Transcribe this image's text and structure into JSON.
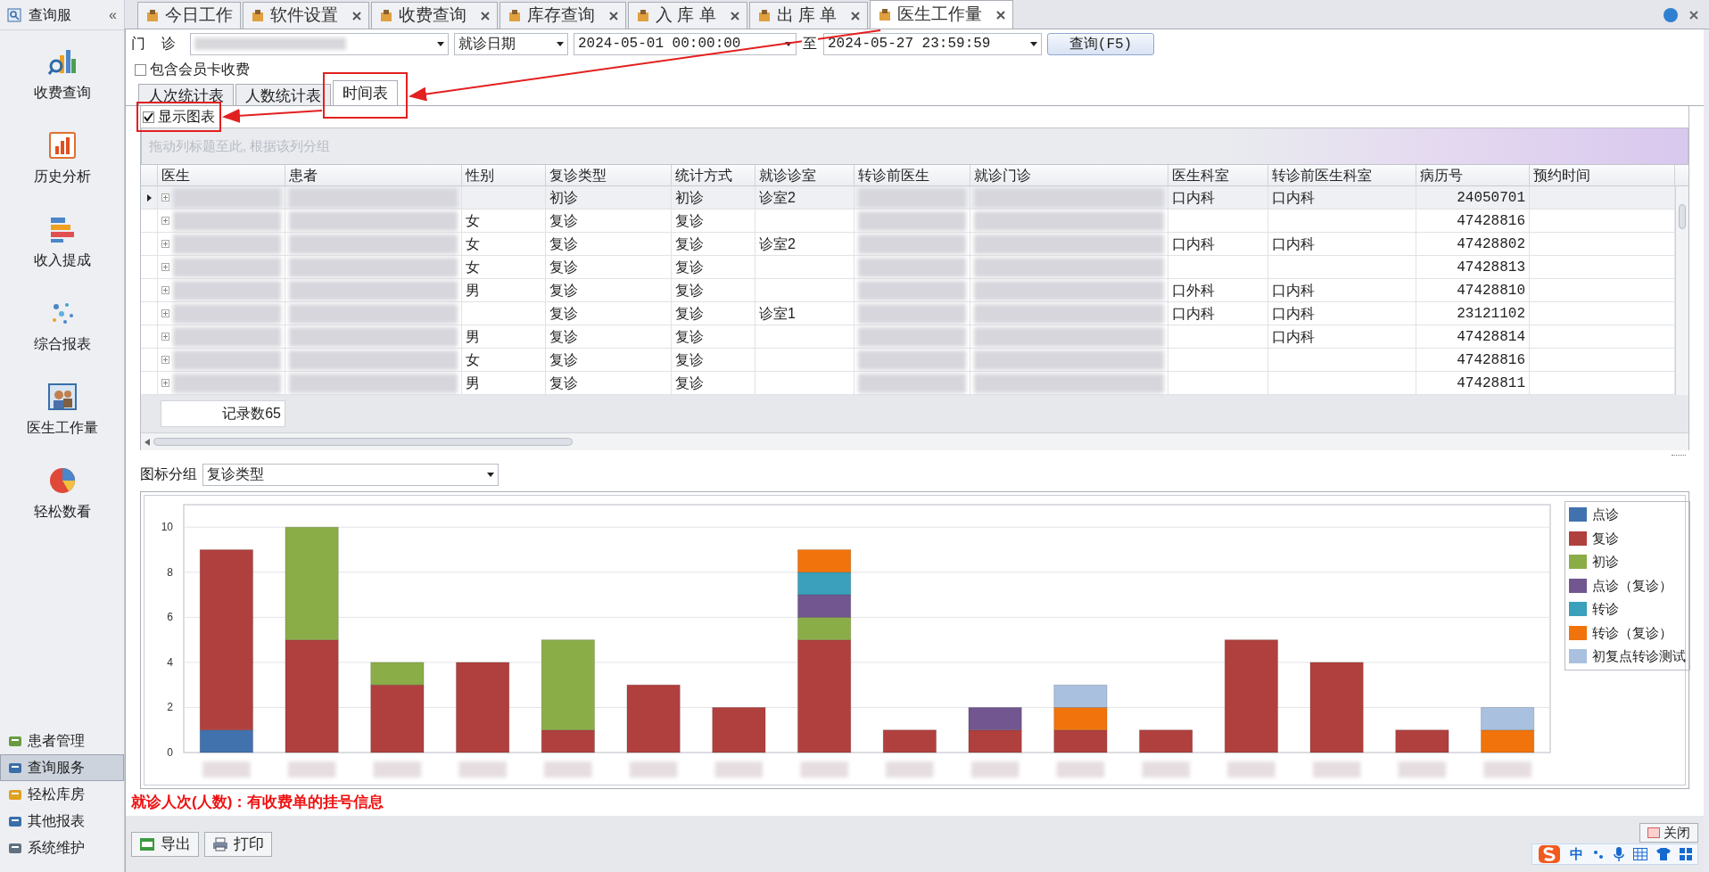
{
  "sidebar": {
    "title": "查询服",
    "collapse": "«",
    "items": [
      {
        "label": "收费查询"
      },
      {
        "label": "历史分析"
      },
      {
        "label": "收入提成"
      },
      {
        "label": "综合报表"
      },
      {
        "label": "医生工作量"
      },
      {
        "label": "轻松数看"
      }
    ],
    "nav": [
      {
        "label": "患者管理",
        "selected": false
      },
      {
        "label": "查询服务",
        "selected": true
      },
      {
        "label": "轻松库房",
        "selected": false
      },
      {
        "label": "其他报表",
        "selected": false
      },
      {
        "label": "系统维护",
        "selected": false
      }
    ]
  },
  "tabs": [
    {
      "label": "今日工作",
      "closable": false,
      "selected": false
    },
    {
      "label": "软件设置",
      "closable": true,
      "selected": false
    },
    {
      "label": "收费查询",
      "closable": true,
      "selected": false
    },
    {
      "label": "库存查询",
      "closable": true,
      "selected": false
    },
    {
      "label": "入 库 单",
      "closable": true,
      "selected": false
    },
    {
      "label": "出 库 单",
      "closable": true,
      "selected": false
    },
    {
      "label": "医生工作量",
      "closable": true,
      "selected": true
    }
  ],
  "filters": {
    "clinic_label": "门    诊",
    "date_type": "就诊日期",
    "start": "2024-05-01 00:00:00",
    "to": "至",
    "end": "2024-05-27 23:59:59",
    "query_button": "查询(F5)",
    "member_card": {
      "label": "包含会员卡收费",
      "checked": false
    }
  },
  "sub_tabs": [
    {
      "label": "人次统计表",
      "selected": false
    },
    {
      "label": "人数统计表",
      "selected": false
    },
    {
      "label": "时间表",
      "selected": true
    }
  ],
  "show_chart": {
    "label": "显示图表",
    "checked": true
  },
  "group_hint": "拖动列标题至此, 根据该列分组",
  "table": {
    "columns": [
      {
        "label": "医生",
        "redacted": true
      },
      {
        "label": "患者",
        "redacted": true
      },
      {
        "label": "性别",
        "redacted": false
      },
      {
        "label": "复诊类型",
        "redacted": false
      },
      {
        "label": "统计方式",
        "redacted": false
      },
      {
        "label": "就诊诊室",
        "redacted": false
      },
      {
        "label": "转诊前医生",
        "redacted": true
      },
      {
        "label": "就诊门诊",
        "redacted": true
      },
      {
        "label": "医生科室",
        "redacted": false
      },
      {
        "label": "转诊前医生科室",
        "redacted": false
      },
      {
        "label": "病历号",
        "redacted": false
      },
      {
        "label": "预约时间",
        "redacted": false
      }
    ],
    "rows": [
      {
        "selected": true,
        "cells": [
          "",
          "",
          "",
          "初诊",
          "初诊",
          "诊室2",
          "",
          "",
          "口内科",
          "口内科",
          "24050701",
          ""
        ]
      },
      {
        "selected": false,
        "cells": [
          "",
          "",
          "女",
          "复诊",
          "复诊",
          "",
          "",
          "",
          "",
          "",
          "47428816",
          ""
        ]
      },
      {
        "selected": false,
        "cells": [
          "",
          "",
          "女",
          "复诊",
          "复诊",
          "诊室2",
          "",
          "",
          "口内科",
          "口内科",
          "47428802",
          ""
        ]
      },
      {
        "selected": false,
        "cells": [
          "",
          "",
          "女",
          "复诊",
          "复诊",
          "",
          "",
          "",
          "",
          "",
          "47428813",
          ""
        ]
      },
      {
        "selected": false,
        "cells": [
          "",
          "",
          "男",
          "复诊",
          "复诊",
          "",
          "",
          "",
          "口外科",
          "口内科",
          "47428810",
          ""
        ]
      },
      {
        "selected": false,
        "cells": [
          "",
          "",
          "",
          "复诊",
          "复诊",
          "诊室1",
          "",
          "",
          "口内科",
          "口内科",
          "23121102",
          ""
        ]
      },
      {
        "selected": false,
        "cells": [
          "",
          "",
          "男",
          "复诊",
          "复诊",
          "",
          "",
          "",
          "",
          "口内科",
          "47428814",
          ""
        ]
      },
      {
        "selected": false,
        "cells": [
          "",
          "",
          "女",
          "复诊",
          "复诊",
          "",
          "",
          "",
          "",
          "",
          "47428816",
          ""
        ]
      },
      {
        "selected": false,
        "cells": [
          "",
          "",
          "男",
          "复诊",
          "复诊",
          "",
          "",
          "",
          "",
          "",
          "47428811",
          ""
        ]
      }
    ],
    "record_count": "记录数65"
  },
  "chart_group": {
    "label": "图标分组",
    "value": "复诊类型"
  },
  "chart": {
    "chart_data": {
      "type": "bar",
      "stacked": true,
      "grid": true,
      "ylim": [
        0,
        11
      ],
      "yticks": [
        0,
        2,
        4,
        6,
        8,
        10
      ],
      "series": [
        {
          "name": "点诊",
          "color": "#4272ae",
          "values": [
            1,
            0,
            0,
            0,
            0,
            0,
            0,
            0,
            0,
            0,
            0,
            0,
            0,
            0,
            0,
            0
          ]
        },
        {
          "name": "复诊",
          "color": "#b0403e",
          "values": [
            8,
            5,
            3,
            4,
            1,
            3,
            2,
            5,
            1,
            1,
            1,
            1,
            5,
            4,
            1,
            0
          ]
        },
        {
          "name": "初诊",
          "color": "#8bad48",
          "values": [
            0,
            5,
            1,
            0,
            4,
            0,
            0,
            1,
            0,
            0,
            0,
            0,
            0,
            0,
            0,
            0
          ]
        },
        {
          "name": "点诊（复诊）",
          "color": "#72568f",
          "values": [
            0,
            0,
            0,
            0,
            0,
            0,
            0,
            1,
            0,
            1,
            0,
            0,
            0,
            0,
            0,
            0
          ]
        },
        {
          "name": "转诊",
          "color": "#3aa0bb",
          "values": [
            0,
            0,
            0,
            0,
            0,
            0,
            0,
            1,
            0,
            0,
            0,
            0,
            0,
            0,
            0,
            0
          ]
        },
        {
          "name": "转诊（复诊）",
          "color": "#f0730c",
          "values": [
            0,
            0,
            0,
            0,
            0,
            0,
            0,
            1,
            0,
            0,
            1,
            0,
            0,
            0,
            0,
            1
          ]
        },
        {
          "name": "初复点转诊测试",
          "color": "#a9c0de",
          "values": [
            0,
            0,
            0,
            0,
            0,
            0,
            0,
            0,
            0,
            0,
            1,
            0,
            0,
            0,
            0,
            1
          ]
        }
      ]
    }
  },
  "note": "就诊人次(人数)：有收费单的挂号信息",
  "bottom_buttons": [
    {
      "label": "导出"
    },
    {
      "label": "打印"
    }
  ],
  "close_button": "关闭",
  "ime": {
    "label": "中"
  }
}
